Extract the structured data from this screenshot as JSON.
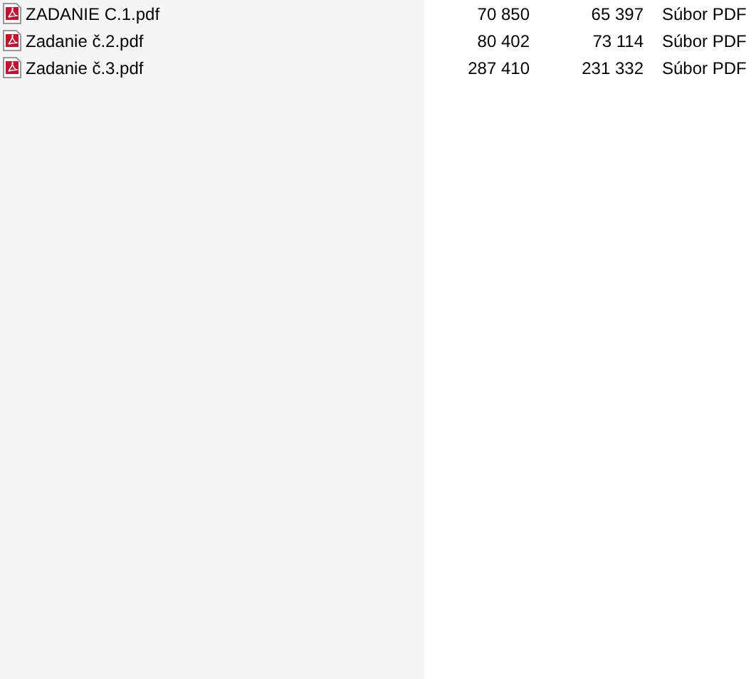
{
  "files": [
    {
      "name": "ZADANIE C.1.pdf",
      "size": "70 850",
      "packed": "65 397",
      "type": "Súbor PDF"
    },
    {
      "name": "Zadanie č.2.pdf",
      "size": "80 402",
      "packed": "73 114",
      "type": "Súbor PDF"
    },
    {
      "name": "Zadanie č.3.pdf",
      "size": "287 410",
      "packed": "231 332",
      "type": "Súbor PDF"
    }
  ]
}
